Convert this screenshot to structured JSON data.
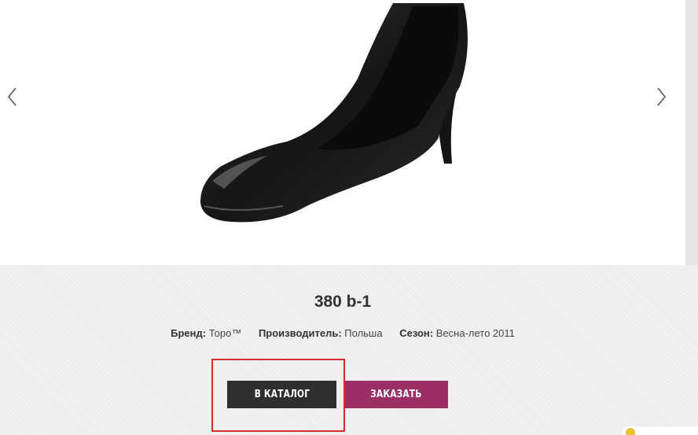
{
  "product": {
    "title": "380 b-1",
    "brand_label": "Бренд:",
    "brand_value": "Торо™",
    "maker_label": "Производитель:",
    "maker_value": "Польша",
    "season_label": "Сезон:",
    "season_value": "Весна-лето 2011"
  },
  "slider": {
    "image_alt": "Black leather high heel pump"
  },
  "buttons": {
    "catalog_label": "В КАТАЛОГ",
    "order_label": "ЗАКАЗАТЬ"
  },
  "colors": {
    "catalog_button": "#2e2e2e",
    "order_button": "#9b2e63",
    "highlight_border": "#d92b2b"
  },
  "icons": {
    "prev": "chevron-left-icon",
    "next": "chevron-right-icon"
  }
}
